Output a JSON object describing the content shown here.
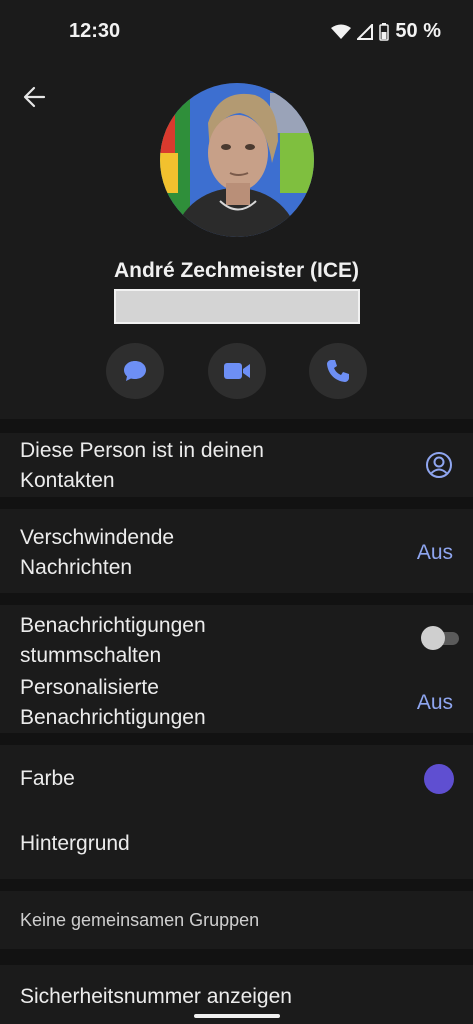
{
  "status": {
    "time": "12:30",
    "battery": "50 %"
  },
  "contact": {
    "name": "André Zechmeister (ICE)"
  },
  "actions": [
    {
      "name": "message"
    },
    {
      "name": "video-call"
    },
    {
      "name": "voice-call"
    }
  ],
  "rows": {
    "in_contacts": "Diese Person ist in deinen\nKontakten",
    "disappearing_label": "Verschwindende\nNachrichten",
    "disappearing_value": "Aus",
    "mute_label": "Benachrichtigungen\nstummschalten",
    "mute_enabled": false,
    "custom_notif_label": "Personalisierte\nBenachrichtigungen",
    "custom_notif_value": "Aus",
    "color_label": "Farbe",
    "wallpaper_label": "Hintergrund",
    "groups_header": "Keine gemeinsamen Gruppen",
    "safety_number": "Sicherheitsnummer anzeigen"
  },
  "colors": {
    "accent": "#8fa6f0",
    "chat_color": "#5f4fd1",
    "icon_blue": "#6d8ff5"
  }
}
